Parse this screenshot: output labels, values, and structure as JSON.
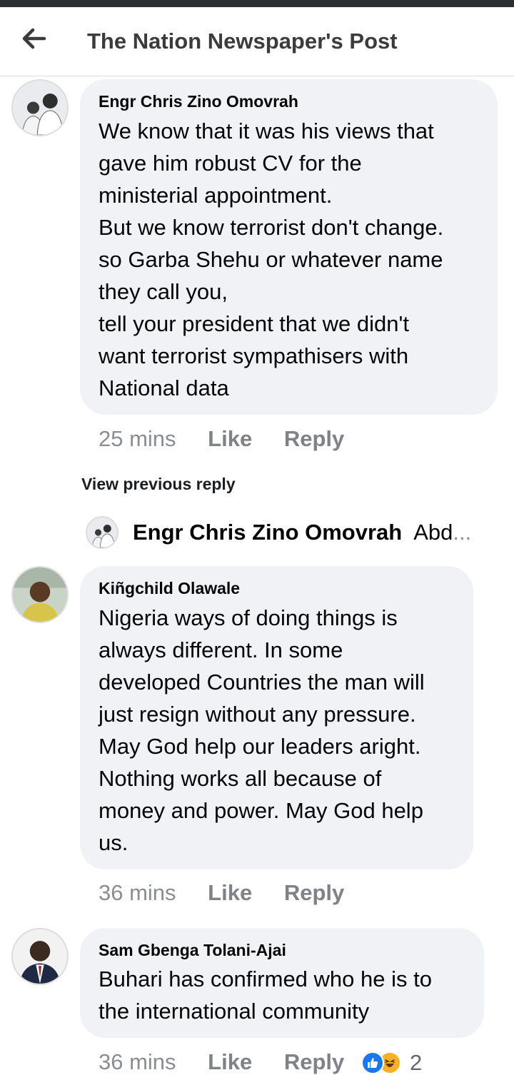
{
  "header": {
    "title": "The Nation Newspaper's Post",
    "back_icon": "arrow-left-icon"
  },
  "comments": [
    {
      "author": "Engr Chris Zino Omovrah",
      "text": "We know that it was his views that\ngave him robust CV for the\nministerial appointment.\nBut we know terrorist don't change.\nso Garba Shehu or whatever name\nthey call you,\ntell your president that we didn't\nwant terrorist sympathisers with\nNational data",
      "time": "25 mins",
      "like_label": "Like",
      "reply_label": "Reply"
    },
    {
      "author": "Kiñgchild Olawale",
      "text": "Nigeria ways of doing things is\nalways different. In some\ndeveloped Countries the man will\njust resign without any pressure.\nMay God help our leaders aright.\nNothing works all because of\nmoney and power. May God help\nus.",
      "time": "36 mins",
      "like_label": "Like",
      "reply_label": "Reply"
    },
    {
      "author": "Sam Gbenga Tolani-Ajai",
      "text": "Buhari has confirmed who he is to\nthe international community",
      "time": "36 mins",
      "like_label": "Like",
      "reply_label": "Reply",
      "reactions": {
        "icons": [
          "like-reaction-icon",
          "haha-reaction-icon"
        ],
        "count": "2"
      }
    }
  ],
  "replies_section": {
    "view_previous_label": "View previous reply",
    "reply_author": "Engr Chris Zino Omovrah",
    "reply_preview": "Abd",
    "ellipsis": "..."
  },
  "colors": {
    "bubble": "#f0f2f5",
    "meta_text": "#8a8d91",
    "like_blue": "#1877f2",
    "haha_yellow": "#f7b125"
  }
}
